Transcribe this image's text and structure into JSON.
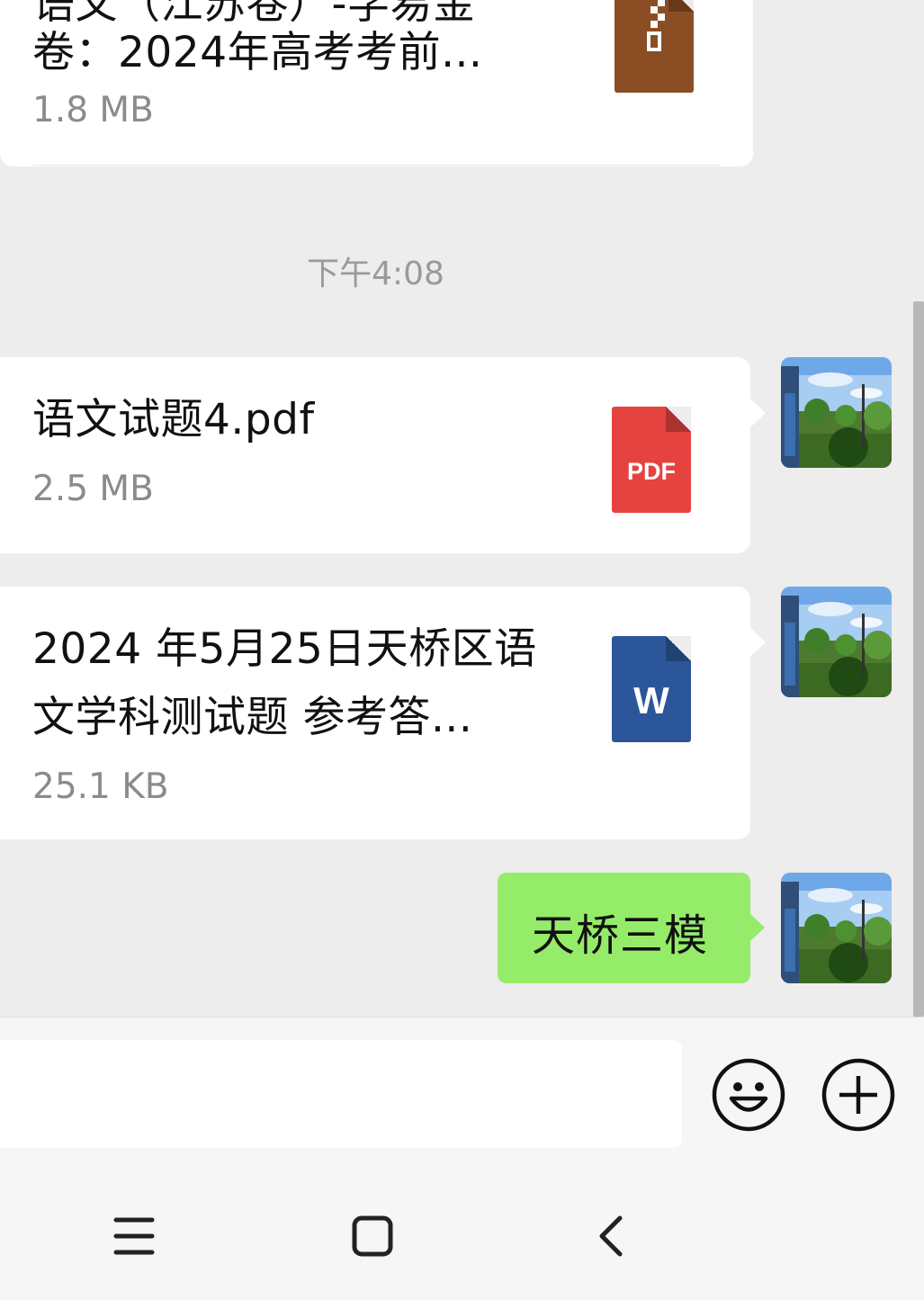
{
  "messages": {
    "zip_file": {
      "name_line1": "语文（江苏卷）-学易金",
      "name_line2": "卷：2024年高考考前...",
      "size": "1.8 MB",
      "icon": "zip-file-icon"
    },
    "timestamp": "下午4:08",
    "pdf_file": {
      "name": "语文试题4.pdf",
      "size": "2.5 MB",
      "icon_label": "PDF"
    },
    "word_file": {
      "name_line1": "2024 年5月25日天桥区语",
      "name_line2": "文学科测试题 参考答...",
      "size": "25.1 KB",
      "icon_label": "W"
    },
    "text_message": "天桥三模"
  },
  "input": {
    "placeholder": "",
    "emoji_icon": "smiley-icon",
    "more_icon": "plus-circle-icon"
  },
  "nav": {
    "menu_icon": "menu-icon",
    "home_icon": "home-square-icon",
    "back_icon": "back-chevron-icon"
  },
  "colors": {
    "background": "#ededed",
    "sent_bubble": "#95ec69",
    "pdf_red": "#e64340",
    "word_blue": "#2b579a",
    "zip_brown": "#8b4e24"
  }
}
